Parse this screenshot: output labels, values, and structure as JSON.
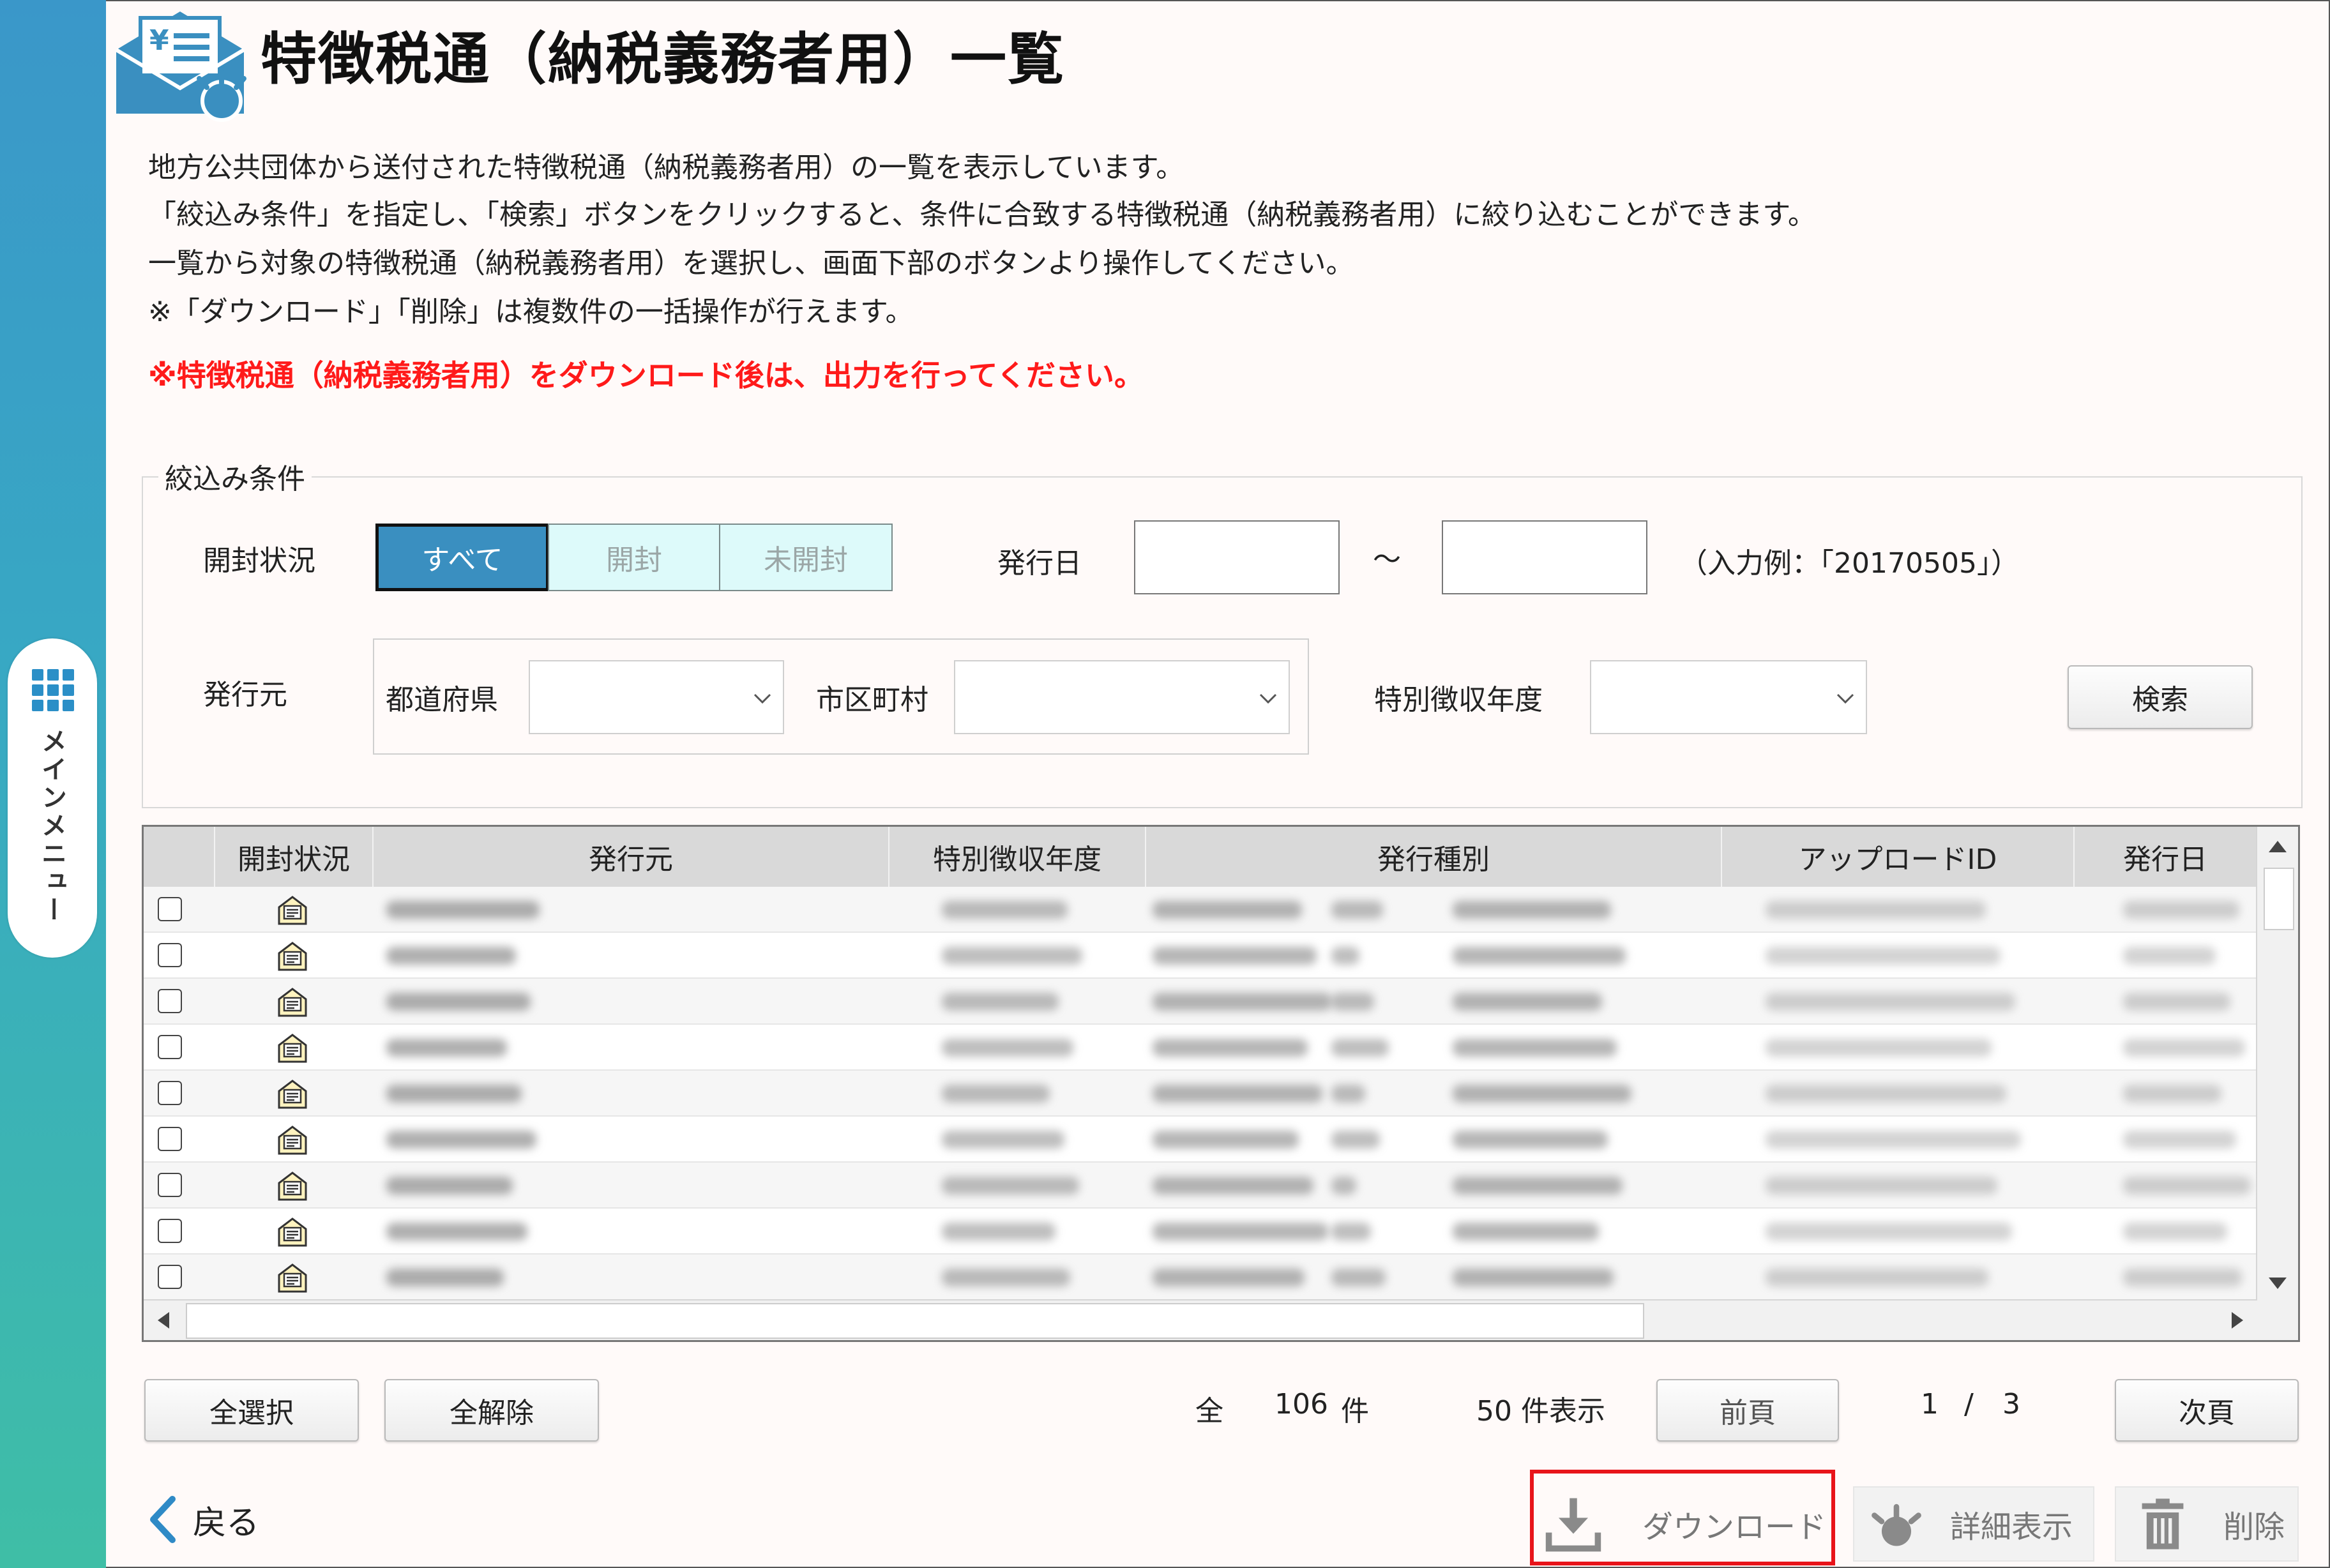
{
  "sidebar": {
    "menu_label": "メインメニュー"
  },
  "header": {
    "title": "特徴税通（納税義務者用）一覧"
  },
  "description": [
    "地方公共団体から送付された特徴税通（納税義務者用）の一覧を表示しています。",
    "「絞込み条件」を指定し、「検索」ボタンをクリックすると、条件に合致する特徴税通（納税義務者用）に絞り込むことができます。",
    "一覧から対象の特徴税通（納税義務者用）を選択し、画面下部のボタンより操作してください。",
    "※「ダウンロード」「削除」は複数件の一括操作が行えます。"
  ],
  "warning": "※特徴税通（納税義務者用）をダウンロード後は、出力を行ってください。",
  "filter": {
    "legend": "絞込み条件",
    "open_status_label": "開封状況",
    "open_status_options": [
      "すべて",
      "開封",
      "未開封"
    ],
    "open_status_selected": "すべて",
    "issue_date_label": "発行日",
    "issue_date_from": "",
    "issue_date_to": "",
    "tilde": "～",
    "date_hint": "（入力例：「20170505」）",
    "issuer_label": "発行元",
    "prefecture_label": "都道府県",
    "prefecture_value": "",
    "city_label": "市区町村",
    "city_value": "",
    "tax_year_label": "特別徴収年度",
    "tax_year_value": "",
    "search_button": "検索"
  },
  "table": {
    "columns": [
      "",
      "開封状況",
      "発行元",
      "特別徴収年度",
      "発行種別",
      "アップロードID",
      "発行日"
    ],
    "visible_rows": 9,
    "row_status_icon": "opened-envelope-icon"
  },
  "pagination": {
    "select_all": "全選択",
    "deselect_all": "全解除",
    "total_prefix": "全",
    "total_count": "106",
    "total_suffix": "件",
    "per_page": "50 件表示",
    "prev": "前頁",
    "current_page": "1",
    "separator": "/",
    "total_pages": "3",
    "next": "次頁"
  },
  "footer": {
    "back": "戻る",
    "download": "ダウンロード",
    "detail": "詳細表示",
    "delete": "削除"
  },
  "colors": {
    "sidebar_top": "#3a97c9",
    "sidebar_bottom": "#3fbea6",
    "selected_segment": "#3a8fc0",
    "warning_red": "#ff1a1a",
    "highlight_box": "#e8141a"
  }
}
